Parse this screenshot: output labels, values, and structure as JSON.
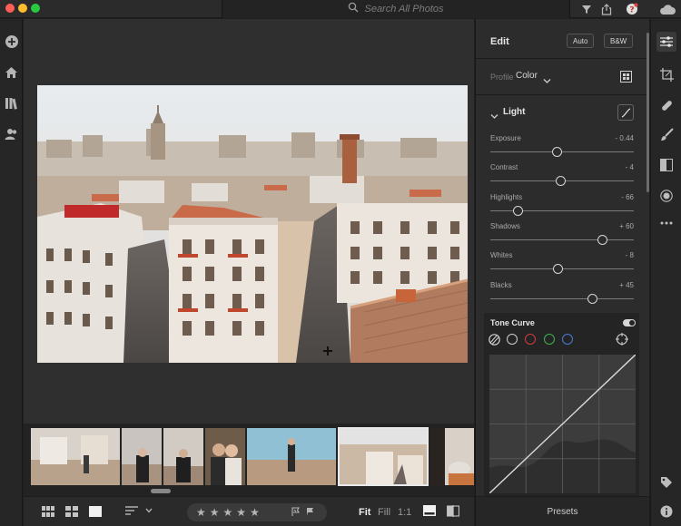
{
  "titlebar": {
    "search_placeholder": "Search All Photos",
    "icons": [
      "search-icon",
      "filter-icon",
      "share-icon",
      "help-icon",
      "cloud-icon"
    ]
  },
  "leftbar": {
    "icons": [
      "add-icon",
      "home-icon",
      "library-icon",
      "people-icon"
    ]
  },
  "edit_panel": {
    "title": "Edit",
    "auto_label": "Auto",
    "bw_label": "B&W",
    "profile_label": "Profile",
    "profile_value": "Color",
    "light_title": "Light",
    "sliders": [
      {
        "label": "Exposure",
        "value": "- 0.44",
        "level": 0.46
      },
      {
        "label": "Contrast",
        "value": "- 4",
        "level": 0.49
      },
      {
        "label": "Highlights",
        "value": "- 66",
        "level": 0.19
      },
      {
        "label": "Shadows",
        "value": "+ 60",
        "level": 0.78
      },
      {
        "label": "Whites",
        "value": "- 8",
        "level": 0.47
      },
      {
        "label": "Blacks",
        "value": "+ 45",
        "level": 0.71
      }
    ],
    "tone_curve_title": "Tone Curve",
    "tone_curve_channels": [
      "parametric",
      "point",
      "red",
      "green",
      "blue"
    ],
    "presets_label": "Presets"
  },
  "bottombar": {
    "zoom_fit": "Fit",
    "zoom_fill": "Fill",
    "zoom_1to1": "1:1",
    "rating_stars": 5
  },
  "rightbar": {
    "icons": [
      "sliders-icon",
      "crop-icon",
      "healing-icon",
      "brush-icon",
      "gradient-icon",
      "radial-icon",
      "more-icon",
      "tag-icon",
      "info-icon"
    ]
  },
  "colors": {
    "accent_red": "#d23c3c",
    "accent_green": "#3fb34f",
    "accent_blue": "#4a7bd8"
  }
}
